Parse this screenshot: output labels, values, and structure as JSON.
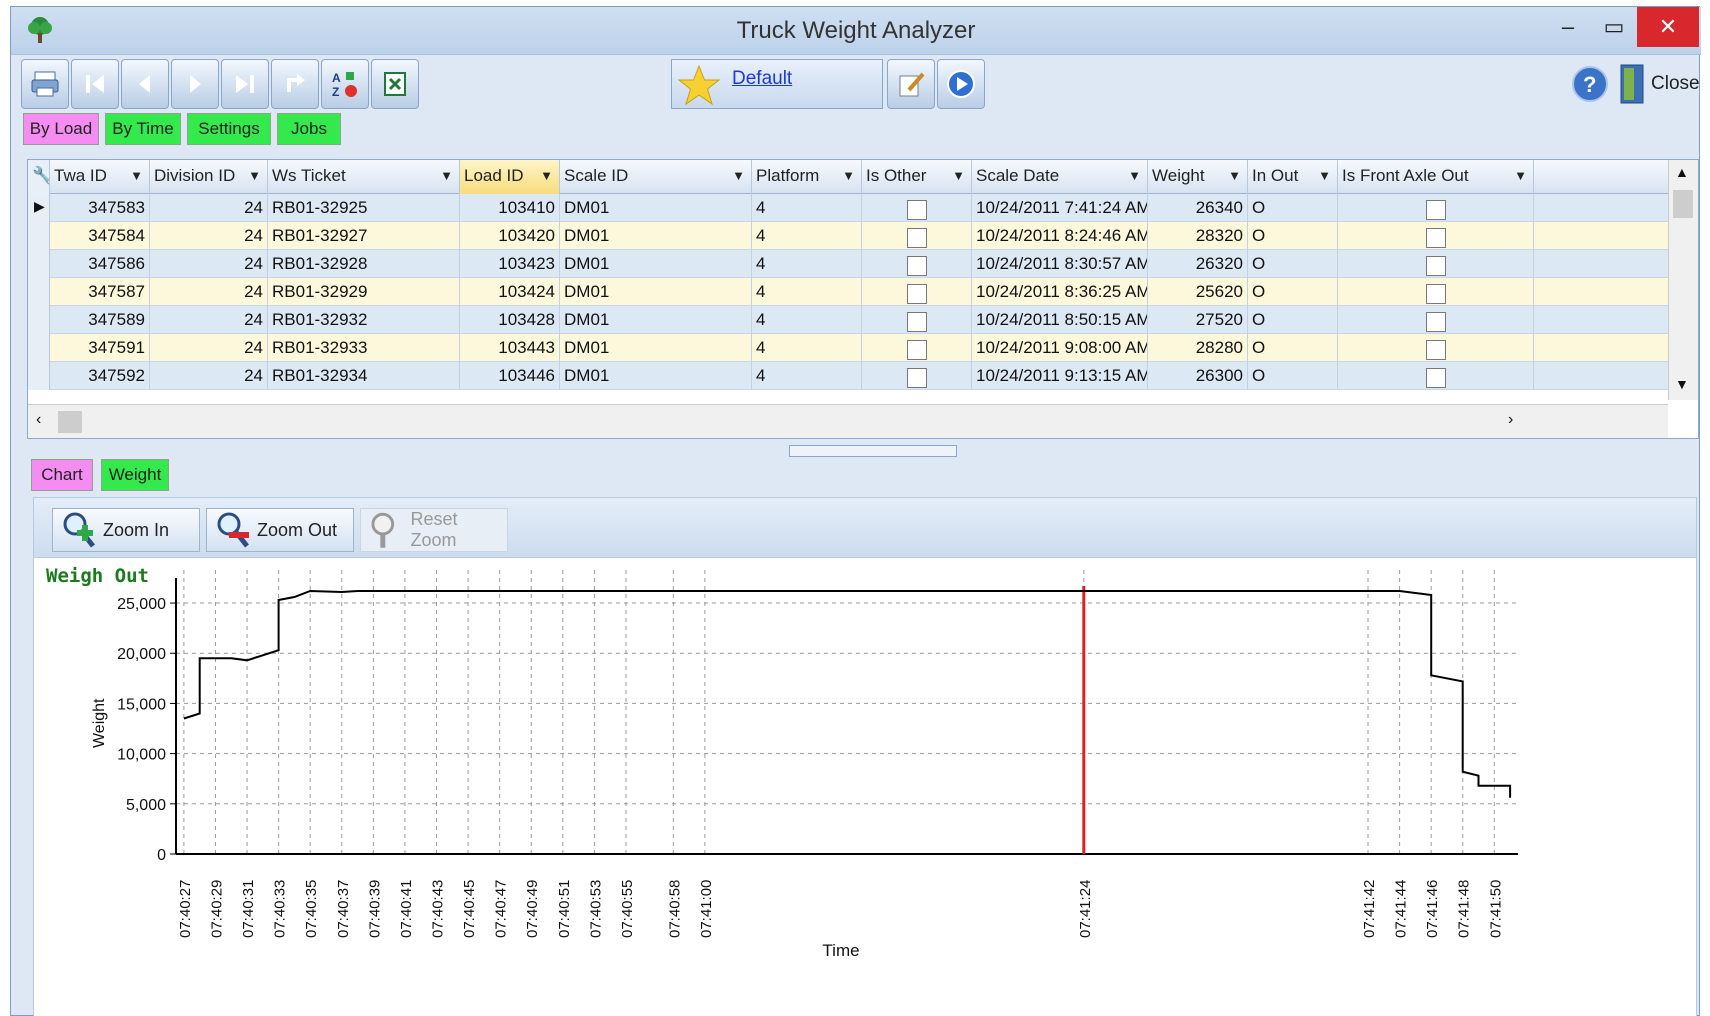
{
  "window": {
    "title": "Truck Weight Analyzer"
  },
  "toolbar": {
    "report_name": "Default",
    "close_label": "Close"
  },
  "tabs_top": [
    {
      "label": "By Load",
      "color": "#f58cf2"
    },
    {
      "label": "By Time",
      "color": "#33e94c"
    },
    {
      "label": "Settings",
      "color": "#33e94c"
    },
    {
      "label": "Jobs",
      "color": "#33e94c"
    }
  ],
  "grid": {
    "columns": [
      "Twa ID",
      "Division ID",
      "Ws Ticket",
      "Load ID",
      "Scale ID",
      "Platform",
      "Is Other",
      "Scale Date",
      "Weight",
      "In Out",
      "Is Front Axle Out"
    ],
    "rows": [
      {
        "twa_id": "347583",
        "division_id": "24",
        "ws_ticket": "RB01-32925",
        "load_id": "103410",
        "scale_id": "DM01",
        "platform": "4",
        "is_other": false,
        "scale_date": "10/24/2011 7:41:24 AM",
        "weight": "26340",
        "in_out": "O",
        "front_axle_out": false
      },
      {
        "twa_id": "347584",
        "division_id": "24",
        "ws_ticket": "RB01-32927",
        "load_id": "103420",
        "scale_id": "DM01",
        "platform": "4",
        "is_other": false,
        "scale_date": "10/24/2011 8:24:46 AM",
        "weight": "28320",
        "in_out": "O",
        "front_axle_out": false
      },
      {
        "twa_id": "347586",
        "division_id": "24",
        "ws_ticket": "RB01-32928",
        "load_id": "103423",
        "scale_id": "DM01",
        "platform": "4",
        "is_other": false,
        "scale_date": "10/24/2011 8:30:57 AM",
        "weight": "26320",
        "in_out": "O",
        "front_axle_out": false
      },
      {
        "twa_id": "347587",
        "division_id": "24",
        "ws_ticket": "RB01-32929",
        "load_id": "103424",
        "scale_id": "DM01",
        "platform": "4",
        "is_other": false,
        "scale_date": "10/24/2011 8:36:25 AM",
        "weight": "25620",
        "in_out": "O",
        "front_axle_out": false
      },
      {
        "twa_id": "347589",
        "division_id": "24",
        "ws_ticket": "RB01-32932",
        "load_id": "103428",
        "scale_id": "DM01",
        "platform": "4",
        "is_other": false,
        "scale_date": "10/24/2011 8:50:15 AM",
        "weight": "27520",
        "in_out": "O",
        "front_axle_out": false
      },
      {
        "twa_id": "347591",
        "division_id": "24",
        "ws_ticket": "RB01-32933",
        "load_id": "103443",
        "scale_id": "DM01",
        "platform": "4",
        "is_other": false,
        "scale_date": "10/24/2011 9:08:00 AM",
        "weight": "28280",
        "in_out": "O",
        "front_axle_out": false
      },
      {
        "twa_id": "347592",
        "division_id": "24",
        "ws_ticket": "RB01-32934",
        "load_id": "103446",
        "scale_id": "DM01",
        "platform": "4",
        "is_other": false,
        "scale_date": "10/24/2011 9:13:15 AM",
        "weight": "26300",
        "in_out": "O",
        "front_axle_out": false
      }
    ]
  },
  "tabs_bottom": [
    {
      "label": "Chart",
      "color": "#f58cf2"
    },
    {
      "label": "Weight",
      "color": "#33e94c"
    }
  ],
  "zoom": {
    "zoom_in": "Zoom In",
    "zoom_out": "Zoom Out",
    "reset_zoom": "Reset Zoom"
  },
  "chart_data": {
    "type": "line",
    "title": "Weigh Out",
    "xlabel": "Time",
    "ylabel": "Weight",
    "ylim": [
      0,
      25000
    ],
    "yticks": [
      "0",
      "5,000",
      "10,000",
      "15,000",
      "20,000",
      "25,000"
    ],
    "xticks": [
      "07:40:27",
      "07:40:29",
      "07:40:31",
      "07:40:33",
      "07:40:35",
      "07:40:37",
      "07:40:39",
      "07:40:41",
      "07:40:43",
      "07:40:45",
      "07:40:47",
      "07:40:49",
      "07:40:51",
      "07:40:53",
      "07:40:55",
      "07:40:58",
      "07:41:00",
      "07:41:24",
      "07:41:42",
      "07:41:44",
      "07:41:46",
      "07:41:48",
      "07:41:50"
    ],
    "grid": true,
    "marker_time": "07:41:24",
    "marker_color": "#e02020",
    "series": [
      {
        "color": "#000000",
        "points": [
          [
            "07:40:27",
            13500
          ],
          [
            "07:40:28",
            14000
          ],
          [
            "07:40:28",
            19500
          ],
          [
            "07:40:30",
            19500
          ],
          [
            "07:40:31",
            19300
          ],
          [
            "07:40:32",
            19800
          ],
          [
            "07:40:33",
            20300
          ],
          [
            "07:40:33",
            25300
          ],
          [
            "07:40:34",
            25600
          ],
          [
            "07:40:35",
            26200
          ],
          [
            "07:40:37",
            26100
          ],
          [
            "07:40:38",
            26200
          ],
          [
            "07:41:44",
            26200
          ],
          [
            "07:41:45",
            26000
          ],
          [
            "07:41:46",
            25800
          ],
          [
            "07:41:46",
            17800
          ],
          [
            "07:41:48",
            17200
          ],
          [
            "07:41:48",
            8200
          ],
          [
            "07:41:49",
            7800
          ],
          [
            "07:41:49",
            6800
          ],
          [
            "07:41:51",
            6800
          ],
          [
            "07:41:51",
            5600
          ]
        ]
      }
    ]
  }
}
